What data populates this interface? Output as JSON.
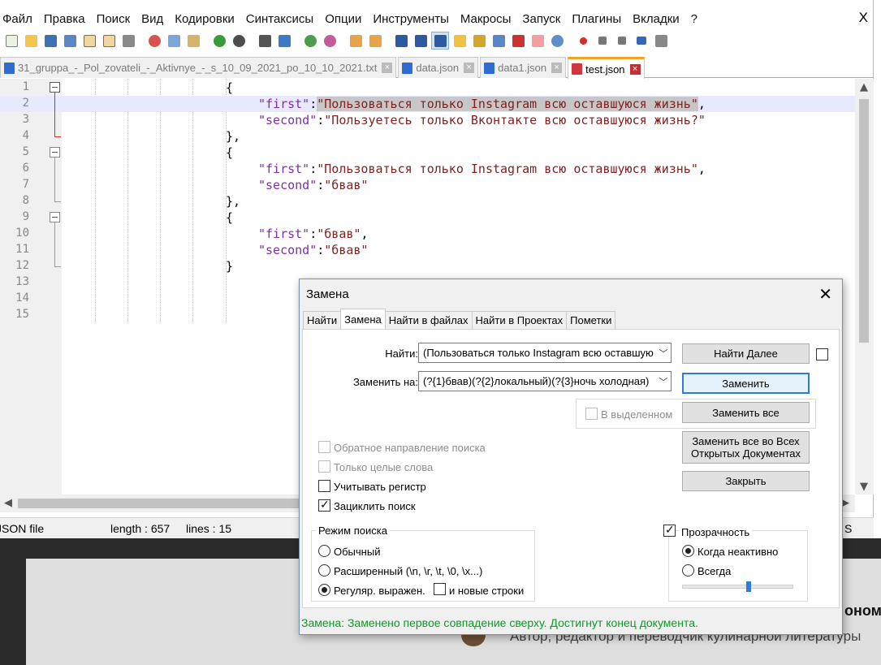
{
  "menu": [
    "Файл",
    "Правка",
    "Поиск",
    "Вид",
    "Кодировки",
    "Синтаксисы",
    "Опции",
    "Инструменты",
    "Макросы",
    "Запуск",
    "Плагины",
    "Вкладки",
    "?"
  ],
  "close_glyph": "X",
  "tabs": [
    {
      "label": "31_gruppa_-_Pol_zovateli_-_Aktivnye_-_s_10_09_2021_po_10_10_2021.txt",
      "close": "×"
    },
    {
      "label": "data.json",
      "close": "×"
    },
    {
      "label": "data1.json",
      "close": "×"
    },
    {
      "label": "test.json",
      "close": "×"
    }
  ],
  "editor": {
    "lines": [
      {
        "n": "1",
        "text": "{"
      },
      {
        "n": "2",
        "key": "\"first\"",
        "sep": ":",
        "val": "\"Пользоваться только Instagram всю оставшуюся жизнь\"",
        "tail": ","
      },
      {
        "n": "3",
        "key": "\"second\"",
        "sep": ":",
        "val": "\"Пользуетесь только Вконтакте всю оставшуюся жизнь?\"",
        "tail": ""
      },
      {
        "n": "4",
        "text": "},"
      },
      {
        "n": "5",
        "text": "{"
      },
      {
        "n": "6",
        "key": "\"first\"",
        "sep": ":",
        "val": "\"Пользоваться только Instagram всю оставшуюся жизнь\"",
        "tail": ","
      },
      {
        "n": "7",
        "key": "\"second\"",
        "sep": ":",
        "val": "\"бвав\"",
        "tail": ""
      },
      {
        "n": "8",
        "text": "},"
      },
      {
        "n": "9",
        "text": "{"
      },
      {
        "n": "10",
        "key": "\"first\"",
        "sep": ":",
        "val": "\"бвав\"",
        "tail": ","
      },
      {
        "n": "11",
        "key": "\"second\"",
        "sep": ":",
        "val": "\"бвав\"",
        "tail": ""
      },
      {
        "n": "12",
        "text": "}"
      },
      {
        "n": "13",
        "text": ""
      },
      {
        "n": "14",
        "text": ""
      },
      {
        "n": "15",
        "text": ""
      }
    ]
  },
  "status": {
    "type": "JSON file",
    "length": "length : 657",
    "lines": "lines : 15",
    "right": "S"
  },
  "dialog": {
    "title": "Замена",
    "close": "✕",
    "tabs": [
      "Найти",
      "Замена",
      "Найти в файлах",
      "Найти в Проектах",
      "Пометки"
    ],
    "find_label": "Найти:",
    "find_value": "(Пользоваться только Instagram всю оставшую",
    "replace_label": "Заменить на:",
    "replace_value": "(?{1}бвав)(?{2}локальный)(?{3}ночь холодная)",
    "btn_find_next": "Найти Далее",
    "btn_replace": "Заменить",
    "btn_replace_all": "Заменить все",
    "btn_replace_all_docs": "Заменить все во Всех Открытых Документах",
    "btn_close": "Закрыть",
    "in_selection": "В выделенном",
    "opt_backward": "Обратное направление поиска",
    "opt_whole_word": "Только целые слова",
    "opt_match_case": "Учитывать регистр",
    "opt_wrap": "Зациклить поиск",
    "search_mode_title": "Режим поиска",
    "mode_normal": "Обычный",
    "mode_extended": "Расширенный (\\n, \\r, \\t, \\0, \\x...)",
    "mode_regex": "Регуляр. выражен.",
    "regex_newline": "и новые строки",
    "transparency": "Прозрачность",
    "trans_inactive": "Когда неактивно",
    "trans_always": "Всегда",
    "transparency_level": 0.6,
    "status_message": "Замена: Заменено первое совпадение сверху. Достигнут конец документа."
  },
  "background": {
    "headline": "ономи",
    "subline": "Автор, редактор и переводчик кулинарной литературы"
  }
}
